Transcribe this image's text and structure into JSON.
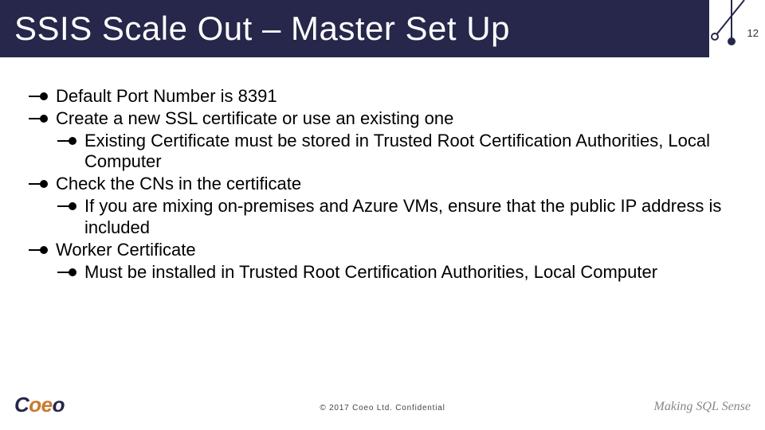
{
  "header": {
    "title": "SSIS Scale Out – Master Set Up"
  },
  "pageNumber": "12",
  "bullets": {
    "i0": "Default Port Number is 8391",
    "i1": "Create a new SSL certificate or use an existing one",
    "i1a": "Existing Certificate must be stored in Trusted Root Certification Authorities, Local Computer",
    "i2": "Check the CNs in the certificate",
    "i2a": "If you are mixing on-premises and Azure VMs, ensure that the public IP address is included",
    "i3": "Worker Certificate",
    "i3a": "Must be installed in Trusted Root Certification Authorities, Local Computer"
  },
  "footer": {
    "copyright": "© 2017 Coeo Ltd. Confidential",
    "logoPrefix": "C",
    "logoAccent": "oe",
    "logoSuffix": "o",
    "tagline": "Making SQL Sense"
  }
}
